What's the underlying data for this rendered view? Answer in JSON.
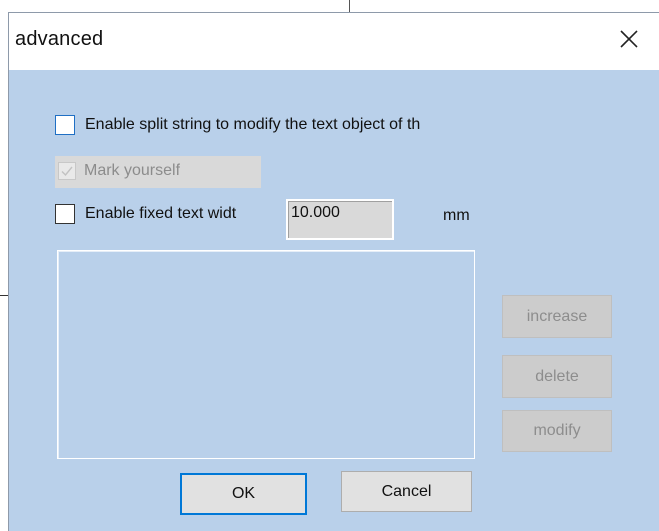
{
  "dialog": {
    "title": "advanced",
    "close_icon": "close-icon"
  },
  "options": {
    "split_string": {
      "label": "Enable split string to modify the text object of th",
      "checked": false
    },
    "mark_yourself": {
      "label": "Mark yourself",
      "checked": true,
      "disabled": true
    },
    "fixed_width": {
      "label": "Enable fixed text widt",
      "checked": false,
      "value": "10.000",
      "unit": "mm"
    }
  },
  "list": {
    "items": []
  },
  "buttons": {
    "increase": "increase",
    "delete": "delete",
    "modify": "modify",
    "ok": "OK",
    "cancel": "Cancel"
  },
  "colors": {
    "dialog_background": "#b9d0ea",
    "titlebar_background": "#ffffff",
    "disabled_button": "#cccccc",
    "default_button_border": "#0078d7"
  }
}
